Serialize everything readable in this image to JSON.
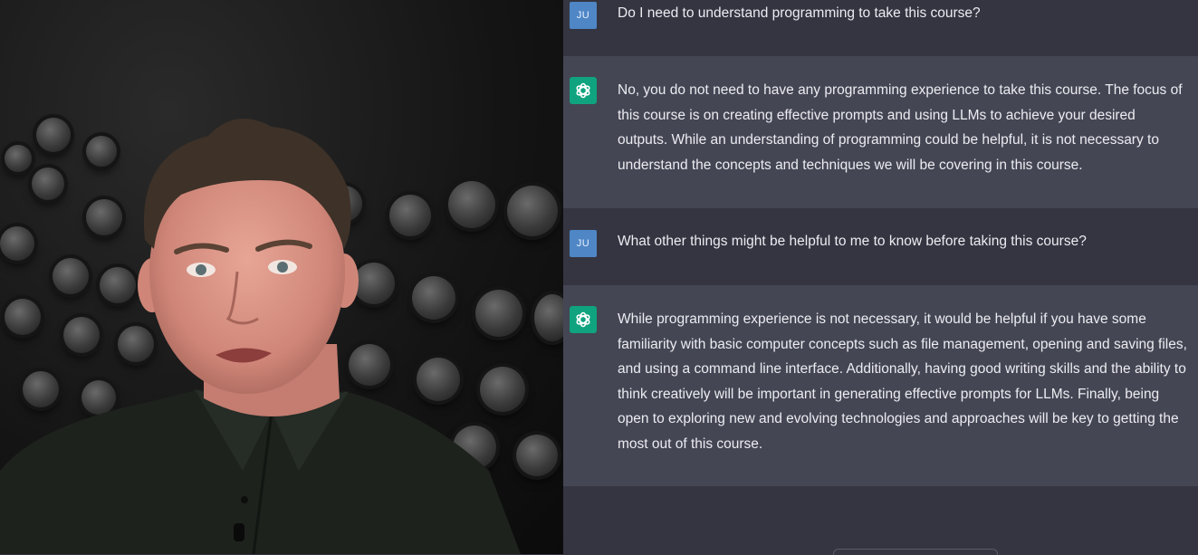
{
  "conversation": {
    "user_initials": "JU",
    "messages": [
      {
        "role": "user",
        "text": "Do I need to understand programming to take this course?"
      },
      {
        "role": "assistant",
        "text": "No, you do not need to have any programming experience to take this course. The focus of this course is on creating effective prompts and using LLMs to achieve your desired outputs. While an understanding of programming could be helpful, it is not necessary to understand the concepts and techniques we will be covering in this course."
      },
      {
        "role": "user",
        "text": "What other things might be helpful to me to know before taking this course?"
      },
      {
        "role": "assistant",
        "text": "While programming experience is not necessary, it would be helpful if you have some familiarity with basic computer concepts such as file management, opening and saving files, and using a command line interface. Additionally, having good writing skills and the ability to think creatively will be important in generating effective prompts for LLMs. Finally, being open to exploring new and evolving technologies and approaches will be key to getting the most out of this course."
      }
    ]
  },
  "colors": {
    "chat_bg": "#343541",
    "assistant_bg": "#444654",
    "user_avatar": "#4f86c6",
    "assistant_avatar": "#10a37f"
  },
  "icons": {
    "assistant": "openai-logo-icon"
  }
}
